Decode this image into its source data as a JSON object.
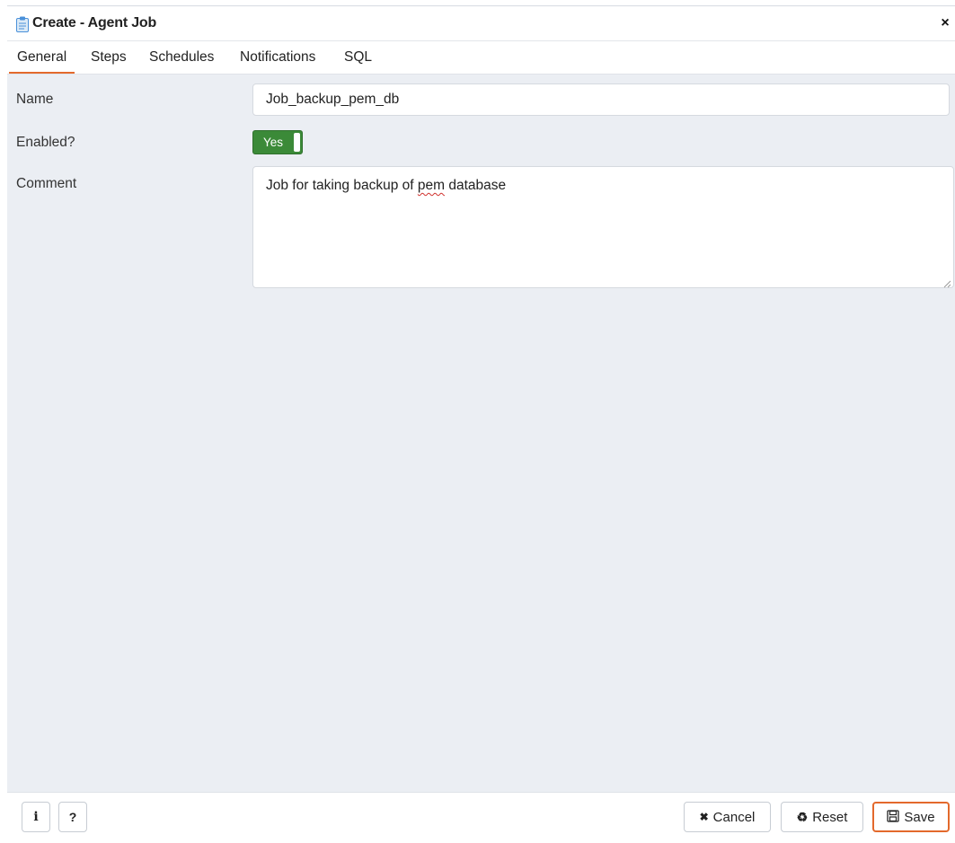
{
  "dialog": {
    "title": "Create - Agent Job",
    "title_icon": "clipboard-icon",
    "close_icon": "close-icon",
    "close_glyph": "×"
  },
  "tabs": [
    {
      "label": "General",
      "active": true
    },
    {
      "label": "Steps",
      "active": false
    },
    {
      "label": "Schedules",
      "active": false
    },
    {
      "label": "Notifications",
      "active": false
    },
    {
      "label": "SQL",
      "active": false
    }
  ],
  "form": {
    "name_label": "Name",
    "name_value": "Job_backup_pem_db",
    "enabled_label": "Enabled?",
    "enabled_value": "Yes",
    "comment_label": "Comment",
    "comment_before": "Job for taking backup of ",
    "comment_misspelled": "pem",
    "comment_after": " database"
  },
  "footer": {
    "info_glyph": "i",
    "help_glyph": "?",
    "cancel_glyph": "✖",
    "cancel_label": "Cancel",
    "reset_glyph": "♻",
    "reset_label": "Reset",
    "save_glyph": "🖫",
    "save_label": "Save"
  },
  "colors": {
    "accent": "#e3692c",
    "toggle_on": "#3b8a38",
    "panel_bg": "#ebeef3"
  }
}
